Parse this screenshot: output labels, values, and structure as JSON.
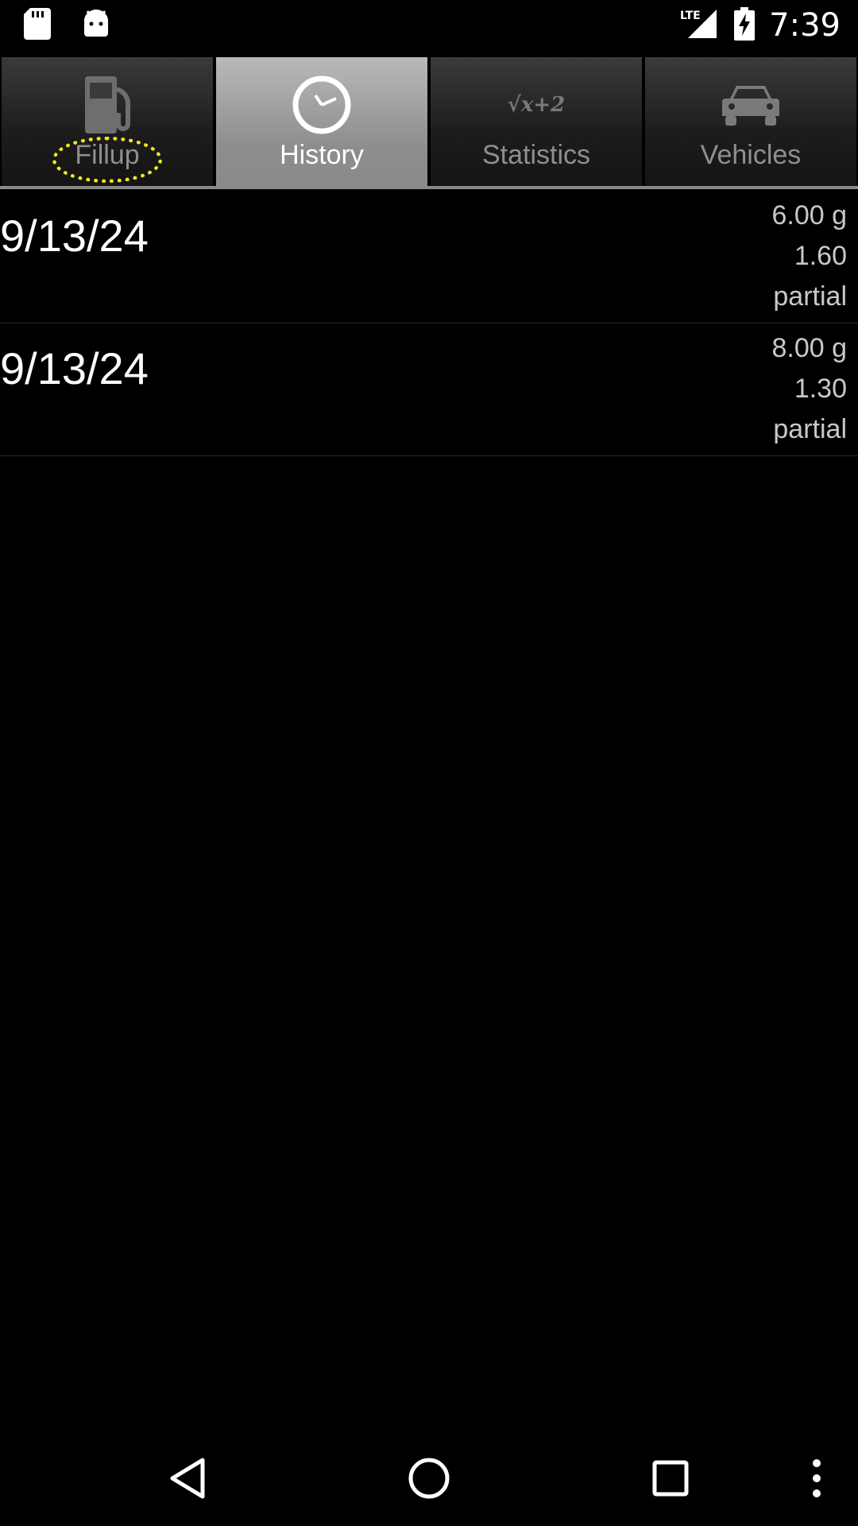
{
  "status_bar": {
    "time": "7:39",
    "network_label": "LTE",
    "icons": [
      "sd-card-icon",
      "android-icon",
      "lte-signal-icon",
      "battery-charging-icon"
    ]
  },
  "tabs": [
    {
      "label": "Fillup",
      "icon": "gas-pump-icon",
      "selected": false
    },
    {
      "label": "History",
      "icon": "clock-icon",
      "selected": true
    },
    {
      "label": "Statistics",
      "icon": "formula-icon",
      "icon_text": "√x+2",
      "selected": false
    },
    {
      "label": "Vehicles",
      "icon": "car-icon",
      "selected": false
    }
  ],
  "history": [
    {
      "date": "9/13/24",
      "amount": "6.00 g",
      "value": "1.60",
      "type": "partial"
    },
    {
      "date": "9/13/24",
      "amount": "8.00 g",
      "value": "1.30",
      "type": "partial"
    }
  ],
  "nav_bar": {
    "icons": [
      "back-icon",
      "home-icon",
      "recents-icon",
      "overflow-menu-icon"
    ]
  },
  "colors": {
    "highlight": "#f2ea1c",
    "active_tab": "#a0a0a0",
    "inactive_tab": "#1c1c1c"
  }
}
